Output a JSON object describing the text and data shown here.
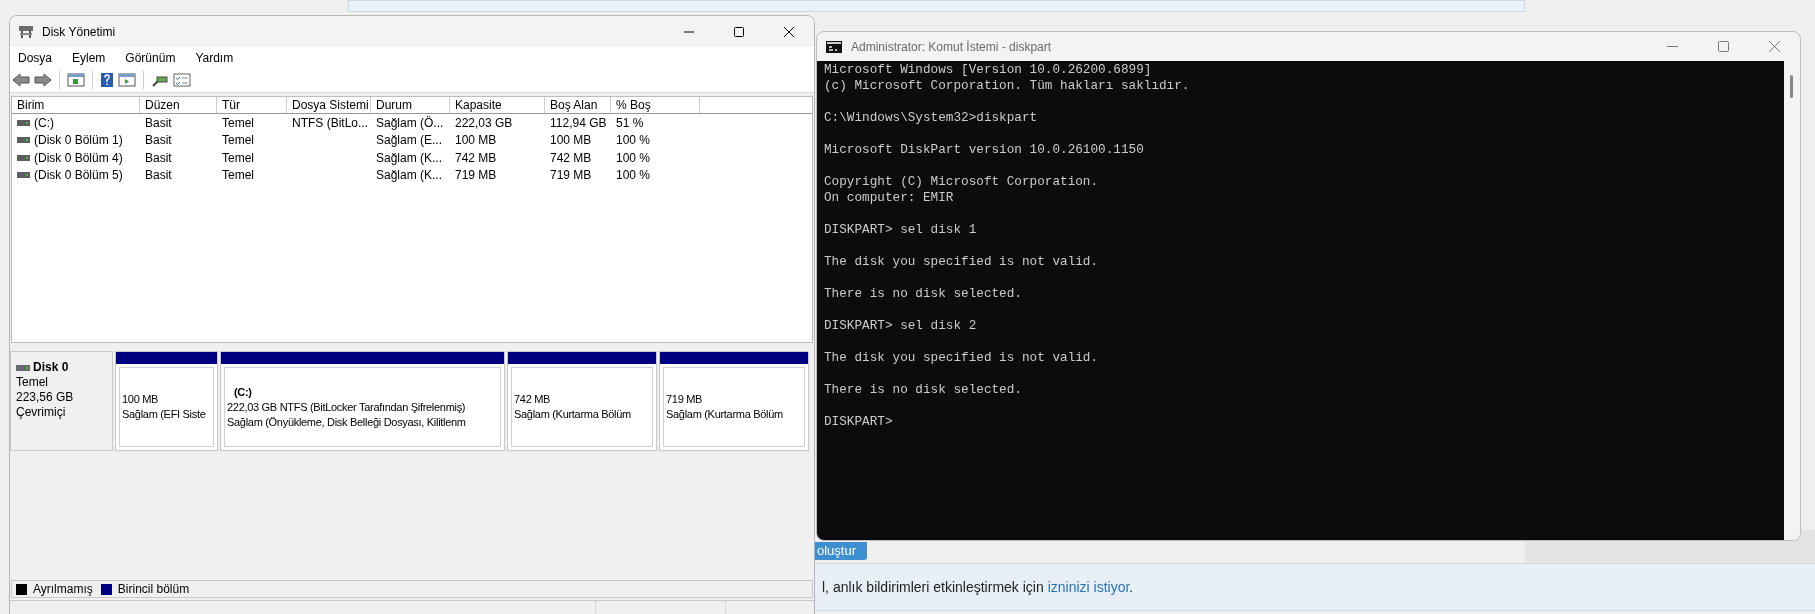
{
  "background_page": {
    "button": "oluştur",
    "notice": {
      "text": "l, anlık bildirimleri etkinleştirmek için ",
      "link": "izninizi istiyor",
      "tail": "."
    }
  },
  "disk_management": {
    "title": "Disk Yönetimi",
    "menu": [
      "Dosya",
      "Eylem",
      "Görünüm",
      "Yardım"
    ],
    "table": {
      "columns": [
        "Birim",
        "Düzen",
        "Tür",
        "Dosya Sistemi",
        "Durum",
        "Kapasite",
        "Boş Alan",
        "% Boş"
      ],
      "rows": [
        [
          "(C:)",
          "Basit",
          "Temel",
          "NTFS (BitLo...",
          "Sağlam (Ö...",
          "222,03 GB",
          "112,94 GB",
          "51 %"
        ],
        [
          "(Disk 0 Bölüm 1)",
          "Basit",
          "Temel",
          "",
          "Sağlam (E...",
          "100 MB",
          "100 MB",
          "100 %"
        ],
        [
          "(Disk 0 Bölüm 4)",
          "Basit",
          "Temel",
          "",
          "Sağlam (K...",
          "742 MB",
          "742 MB",
          "100 %"
        ],
        [
          "(Disk 0 Bölüm 5)",
          "Basit",
          "Temel",
          "",
          "Sağlam (K...",
          "719 MB",
          "719 MB",
          "100 %"
        ]
      ]
    },
    "disk": {
      "name": "Disk 0",
      "type": "Temel",
      "size": "223,56 GB",
      "status": "Çevrimiçi",
      "partitions": [
        {
          "size": "100 MB",
          "status": "Sağlam (EFI Siste"
        },
        {
          "label": "(C:)",
          "size": "222,03 GB NTFS (BitLocker Tarafından Şifrelenmiş)",
          "status": "Sağlam (Önyükleme, Disk Belleği Dosyası, Kilitlenm"
        },
        {
          "size": "742 MB",
          "status": "Sağlam (Kurtarma Bölüm"
        },
        {
          "size": "719 MB",
          "status": "Sağlam (Kurtarma Bölüm"
        }
      ]
    },
    "legend": [
      {
        "label": "Ayrılmamış",
        "color": "#000000"
      },
      {
        "label": "Birincil bölüm",
        "color": "#000080"
      }
    ]
  },
  "command_prompt": {
    "title": "Administrator: Komut İstemi - diskpart",
    "blocks": [
      [
        "Microsoft Windows [Version 10.0.26200.6899]",
        "(c) Microsoft Corporation. Tüm hakları saklıdır."
      ],
      [
        "C:\\Windows\\System32>diskpart"
      ],
      [
        "Microsoft DiskPart version 10.0.26100.1150"
      ],
      [
        "Copyright (C) Microsoft Corporation.",
        "On computer: EMIR"
      ],
      [
        "DISKPART> sel disk 1"
      ],
      [
        "The disk you specified is not valid."
      ],
      [
        "There is no disk selected."
      ],
      [
        "DISKPART> sel disk 2"
      ],
      [
        "The disk you specified is not valid."
      ],
      [
        "There is no disk selected."
      ],
      [
        "DISKPART>"
      ]
    ]
  }
}
